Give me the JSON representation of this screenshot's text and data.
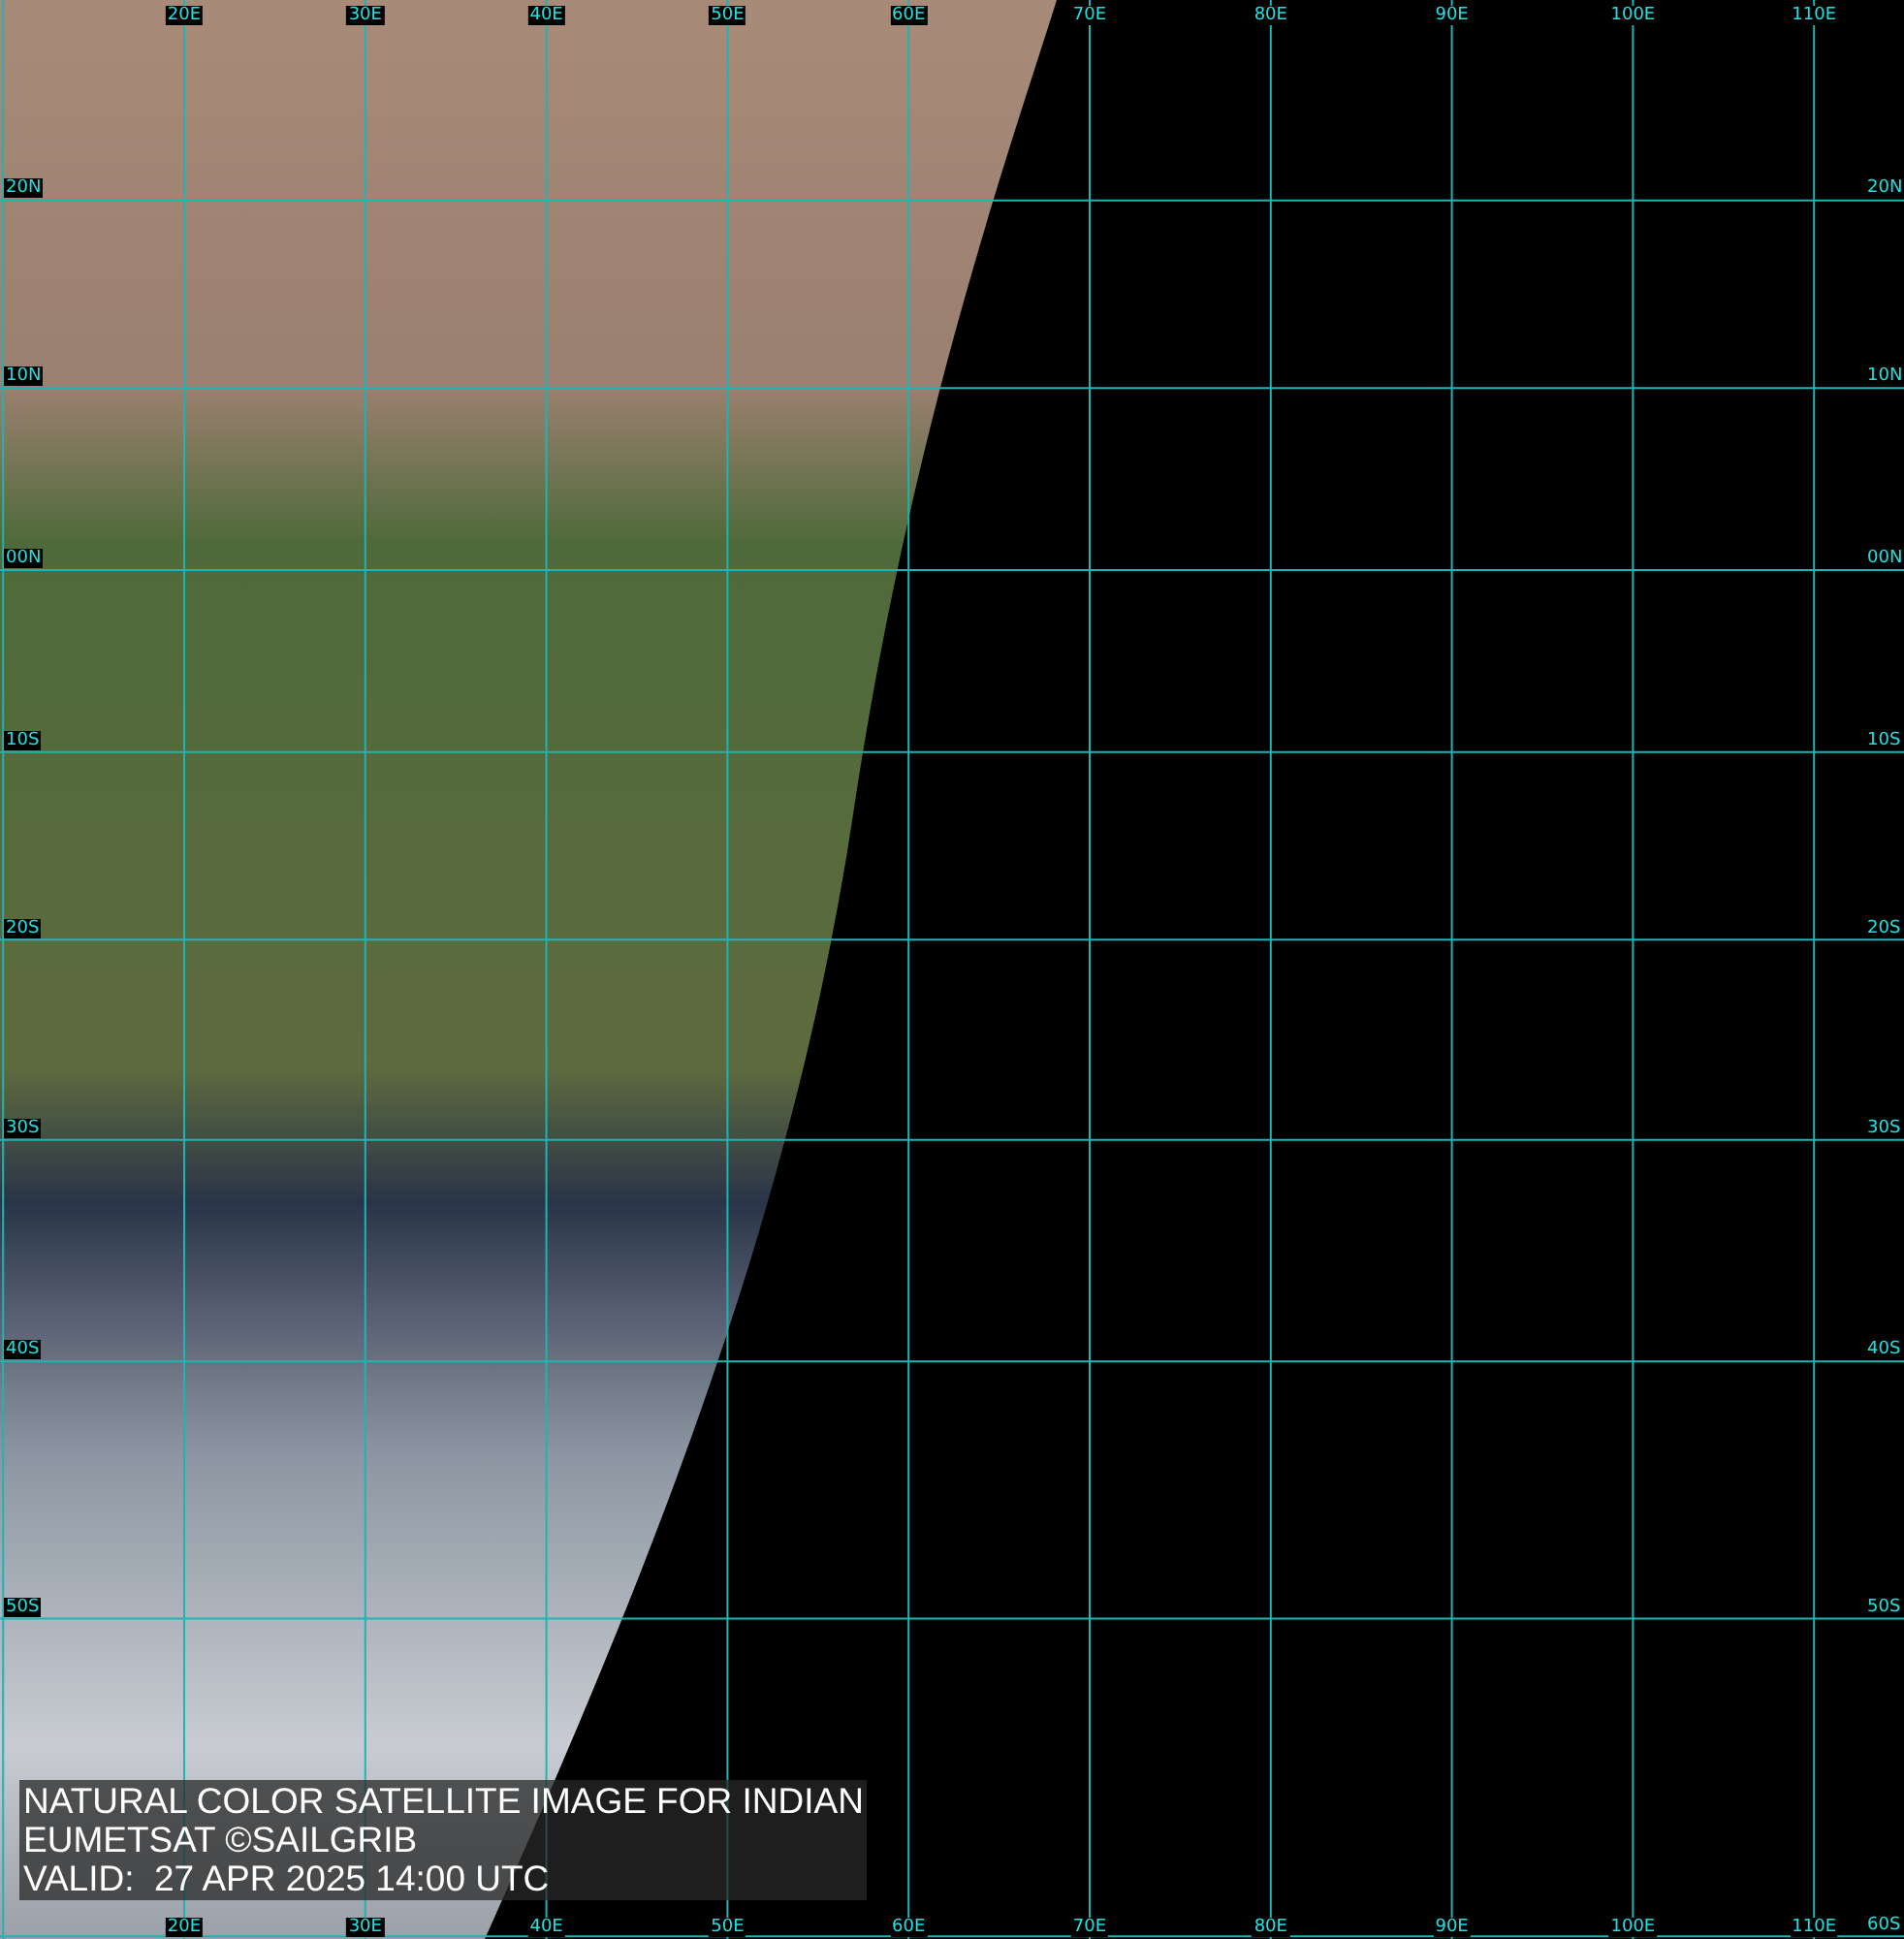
{
  "map": {
    "meridians": [
      {
        "label_top": "20E",
        "label_bottom": "20E"
      },
      {
        "label_top": "30E",
        "label_bottom": "30E"
      },
      {
        "label_top": "40E",
        "label_bottom": "40E"
      },
      {
        "label_top": "50E",
        "label_bottom": "50E"
      },
      {
        "label_top": "60E",
        "label_bottom": "60E"
      },
      {
        "label_top": "70E",
        "label_bottom": "70E"
      },
      {
        "label_top": "80E",
        "label_bottom": "80E"
      },
      {
        "label_top": "90E",
        "label_bottom": "90E"
      },
      {
        "label_top": "100E",
        "label_bottom": "100E"
      },
      {
        "label_top": "110E",
        "label_bottom": "110E"
      }
    ],
    "parallels": [
      {
        "label_left": "20N",
        "label_right": "20N"
      },
      {
        "label_left": "10N",
        "label_right": "10N"
      },
      {
        "label_left": "00N",
        "label_right": "00N"
      },
      {
        "label_left": "10S",
        "label_right": "10S"
      },
      {
        "label_left": "20S",
        "label_right": "20S"
      },
      {
        "label_left": "30S",
        "label_right": "30S"
      },
      {
        "label_left": "40S",
        "label_right": "40S"
      },
      {
        "label_left": "50S",
        "label_right": "50S"
      },
      {
        "label_right": "60S"
      }
    ],
    "caption": [
      "NATURAL COLOR SATELLITE IMAGE FOR INDIAN",
      "EUMETSAT ©SAILGRIB",
      "VALID:  27 APR 2025 14:00 UTC"
    ]
  }
}
